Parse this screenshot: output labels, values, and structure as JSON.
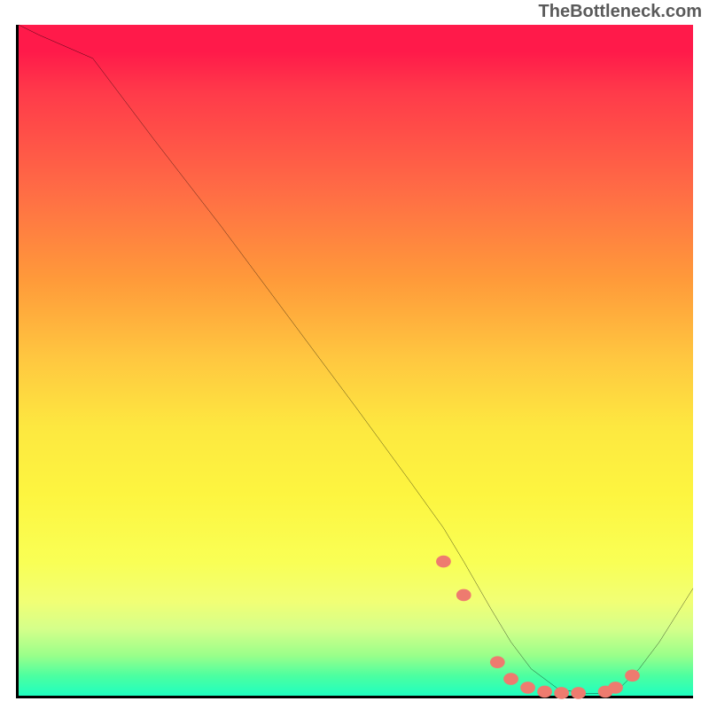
{
  "attribution": "TheBottleneck.com",
  "chart_data": {
    "type": "line",
    "title": "",
    "xlabel": "",
    "ylabel": "",
    "xlim": [
      0,
      100
    ],
    "ylim": [
      0,
      100
    ],
    "series": [
      {
        "name": "curve",
        "x": [
          0,
          3,
          11,
          20,
          30,
          40,
          50,
          58,
          63,
          66,
          70,
          73,
          76,
          80,
          84,
          87,
          89,
          92,
          95,
          100
        ],
        "y": [
          100,
          98.5,
          95,
          83,
          70,
          56.5,
          43,
          32,
          25,
          20,
          13,
          8,
          4,
          1,
          0.3,
          0.3,
          1,
          4,
          8,
          16
        ]
      }
    ],
    "markers": {
      "name": "dots",
      "x": [
        63,
        66,
        71,
        73,
        75.5,
        78,
        80.5,
        83,
        87,
        88.5,
        91
      ],
      "y": [
        20,
        15,
        5,
        2.5,
        1.2,
        0.6,
        0.4,
        0.4,
        0.6,
        1.2,
        3
      ]
    },
    "gradient_stops": [
      {
        "pos": 0,
        "color": "#ff1a4a"
      },
      {
        "pos": 25,
        "color": "#ff6d45"
      },
      {
        "pos": 50,
        "color": "#ffc840"
      },
      {
        "pos": 70,
        "color": "#fdf540"
      },
      {
        "pos": 90,
        "color": "#d5ff8a"
      },
      {
        "pos": 100,
        "color": "#1effc0"
      }
    ]
  }
}
